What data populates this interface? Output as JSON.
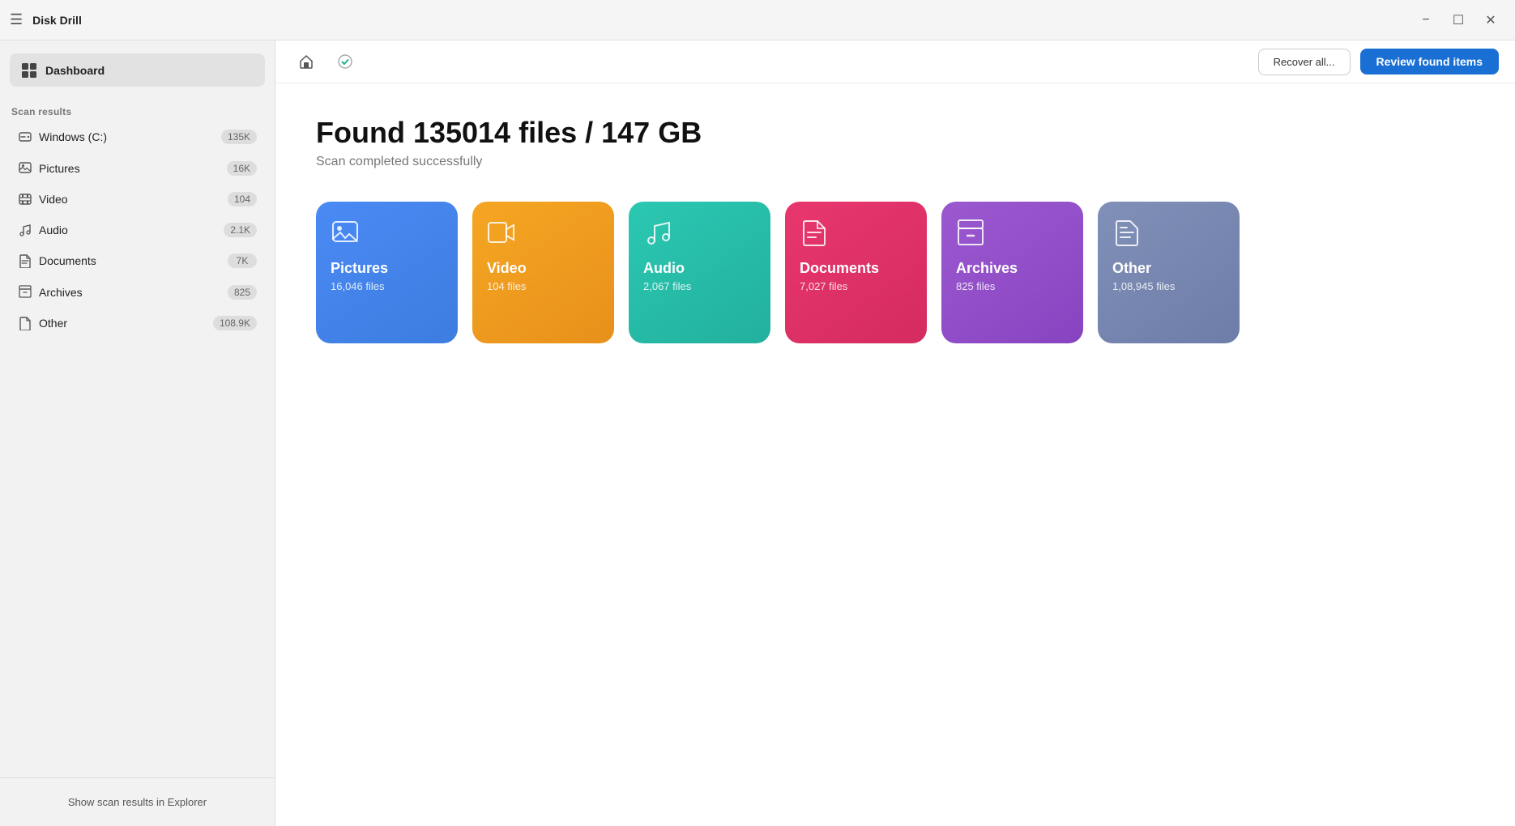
{
  "titleBar": {
    "title": "Disk Drill",
    "minimizeLabel": "−",
    "maximizeLabel": "☐",
    "closeLabel": "✕"
  },
  "sidebar": {
    "dashboardLabel": "Dashboard",
    "scanResultsLabel": "Scan results",
    "showExplorerLabel": "Show scan results in Explorer",
    "items": [
      {
        "id": "windows",
        "label": "Windows (C:)",
        "badge": "135K",
        "icon": "drive"
      },
      {
        "id": "pictures",
        "label": "Pictures",
        "badge": "16K",
        "icon": "image"
      },
      {
        "id": "video",
        "label": "Video",
        "badge": "104",
        "icon": "film"
      },
      {
        "id": "audio",
        "label": "Audio",
        "badge": "2.1K",
        "icon": "music"
      },
      {
        "id": "documents",
        "label": "Documents",
        "badge": "7K",
        "icon": "doc"
      },
      {
        "id": "archives",
        "label": "Archives",
        "badge": "825",
        "icon": "archive"
      },
      {
        "id": "other",
        "label": "Other",
        "badge": "108.9K",
        "icon": "file"
      }
    ]
  },
  "toolbar": {
    "recoverAllLabel": "Recover all...",
    "reviewFoundLabel": "Review found items"
  },
  "main": {
    "title": "Found 135014 files / 147 GB",
    "subtitle": "Scan completed successfully",
    "categories": [
      {
        "id": "pictures",
        "name": "Pictures",
        "count": "16,046 files",
        "color": "#4a8af4",
        "colorEnd": "#3d7de0"
      },
      {
        "id": "video",
        "name": "Video",
        "count": "104 files",
        "color": "#f5a623",
        "colorEnd": "#e8901a"
      },
      {
        "id": "audio",
        "name": "Audio",
        "count": "2,067 files",
        "color": "#2bc8b2",
        "colorEnd": "#22b09d"
      },
      {
        "id": "documents",
        "name": "Documents",
        "count": "7,027 files",
        "color": "#e8376e",
        "colorEnd": "#d42b60"
      },
      {
        "id": "archives",
        "name": "Archives",
        "count": "825 files",
        "color": "#9b59d0",
        "colorEnd": "#8844c0"
      },
      {
        "id": "other",
        "name": "Other",
        "count": "1,08,945 files",
        "color": "#8090b8",
        "colorEnd": "#6d7da8"
      }
    ]
  }
}
